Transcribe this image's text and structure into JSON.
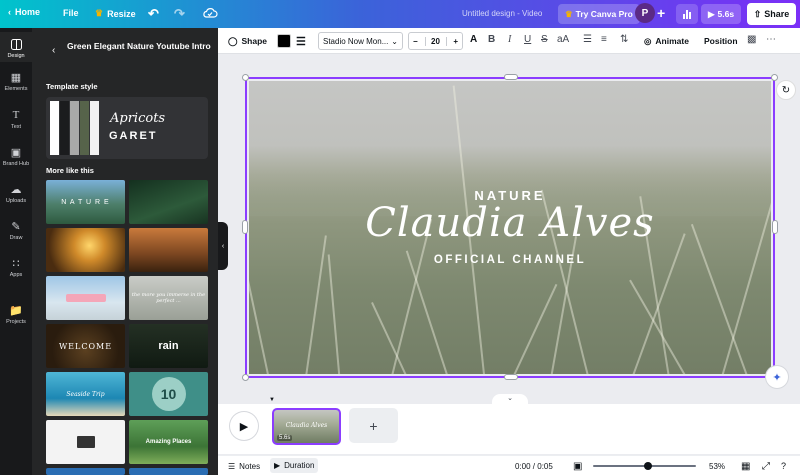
{
  "topbar": {
    "home_label": "Home",
    "file_label": "File",
    "resize_label": "Resize",
    "doc_title": "Untitled design - Video",
    "try_pro_label": "Try Canva Pro",
    "avatar_initial": "P",
    "play_time": "5.6s",
    "share_label": "Share"
  },
  "rail": {
    "items": [
      {
        "label": "Design",
        "icon": "design-icon",
        "active": true
      },
      {
        "label": "Elements",
        "icon": "elements-icon"
      },
      {
        "label": "Text",
        "icon": "text-icon"
      },
      {
        "label": "Brand Hub",
        "icon": "brand-hub-icon"
      },
      {
        "label": "Uploads",
        "icon": "uploads-icon"
      },
      {
        "label": "Draw",
        "icon": "draw-icon"
      },
      {
        "label": "Apps",
        "icon": "apps-icon"
      },
      {
        "label": "Projects",
        "icon": "projects-icon"
      }
    ]
  },
  "panel": {
    "title": "Green Elegant Nature Youtube Intro",
    "template_style_label": "Template style",
    "style_font_primary": "Apricots",
    "style_font_secondary": "GARET",
    "swatches": [
      "#ffffff",
      "#1b1c1e",
      "#a9a9a9",
      "#56634a",
      "#f2f2f2"
    ],
    "more_like_this_label": "More like this",
    "thumbnails": [
      {
        "text": "N A T U R E"
      },
      {
        "text": ""
      },
      {
        "text": ""
      },
      {
        "text": ""
      },
      {
        "text": ""
      },
      {
        "text": "the more you immerse in the perfect ..."
      },
      {
        "text": "WELCOME"
      },
      {
        "text": "rain"
      },
      {
        "text": "Seaside Trip"
      },
      {
        "text": "10"
      },
      {
        "text": ""
      },
      {
        "text": "Amazing Places"
      }
    ]
  },
  "toolbar": {
    "shape_label": "Shape",
    "font_name": "Stadio Now Mon...",
    "font_size": "20",
    "animate_label": "Animate",
    "position_label": "Position",
    "text_color": "#000000"
  },
  "design": {
    "kicker": "NATURE",
    "name": "Claudia Alves",
    "subtitle": "OFFICIAL CHANNEL"
  },
  "timeline": {
    "clip_title": "Claudia Alves",
    "clip_duration": "5.6s",
    "add_label": "+"
  },
  "bottombar": {
    "notes_label": "Notes",
    "duration_label": "Duration",
    "time_readout": "0:00 / 0:05",
    "zoom_label": "53%",
    "zoom_percent": 53
  },
  "colors": {
    "accent": "#8b3dff",
    "panel_bg": "#252627",
    "rail_bg": "#18191b"
  }
}
